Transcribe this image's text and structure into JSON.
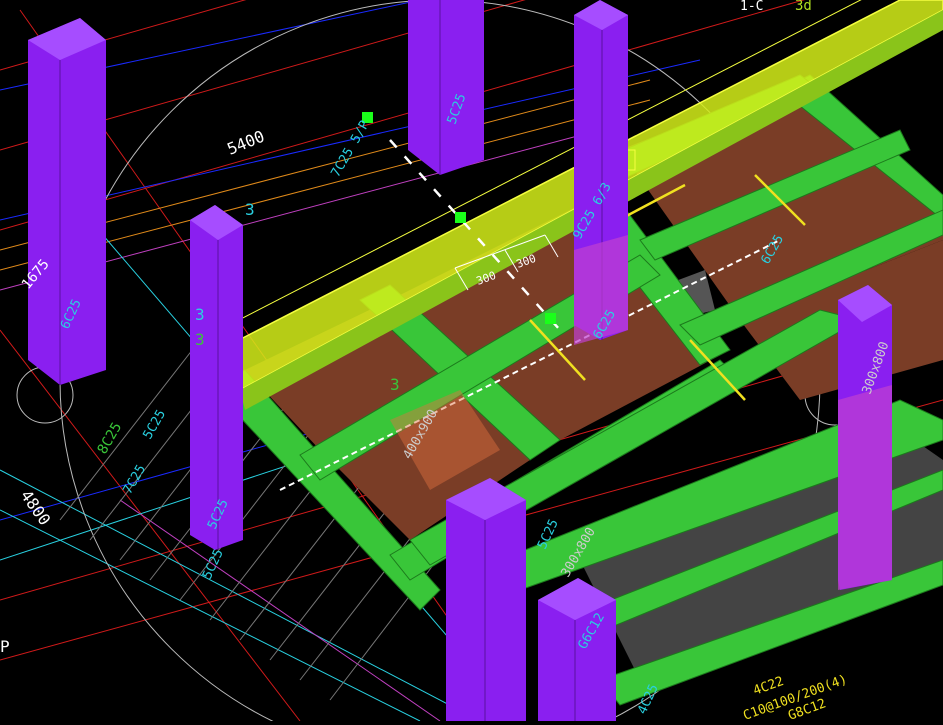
{
  "colors": {
    "background": "#000000",
    "column": "#8a1ff0",
    "column_top": "#a64dff",
    "beam": "#39c639",
    "beam_selected": "#d6f01a",
    "slab": "#7a3d26",
    "axis_red": "#d01a1a",
    "axis_blue": "#1a2aff",
    "cyan": "#29d0e0",
    "white": "#ffffff"
  },
  "dimensions": {
    "span_top": "5400",
    "span_left": "4800",
    "offset_left": "1675",
    "beam_dim_a": "300",
    "beam_dim_b": "300"
  },
  "grid_bubbles": {
    "top": "3",
    "left": "3",
    "bottom_left": "P",
    "top_right_a": "1-C",
    "top_right_b": "3d"
  },
  "annotations": {
    "rebar_top": "7C25 5/P",
    "col_label_1": "5C25",
    "col_label_2": "6C25",
    "col_label_3": "6C25",
    "col_label_4": "5C25",
    "col_label_5": "5C25",
    "col_label_6": "5C25",
    "col_label_7": "4C25",
    "beam_spec_1": "400x900",
    "beam_spec_2": "300x800",
    "beam_spec_3": "300x800",
    "beam_spec_4": "G6C12",
    "stirrup_1": "4C22",
    "stirrup_2": "C10@100/200(4)",
    "stirrup_3": "G8C12",
    "slab_num_1": "3",
    "slab_num_2": "3",
    "rebar_left_1": "8C25",
    "rebar_left_2": "5C25",
    "rebar_left_3": "7C25",
    "rebar_mid_1": "6C25",
    "rebar_mid_2": "9C25 6/3"
  }
}
